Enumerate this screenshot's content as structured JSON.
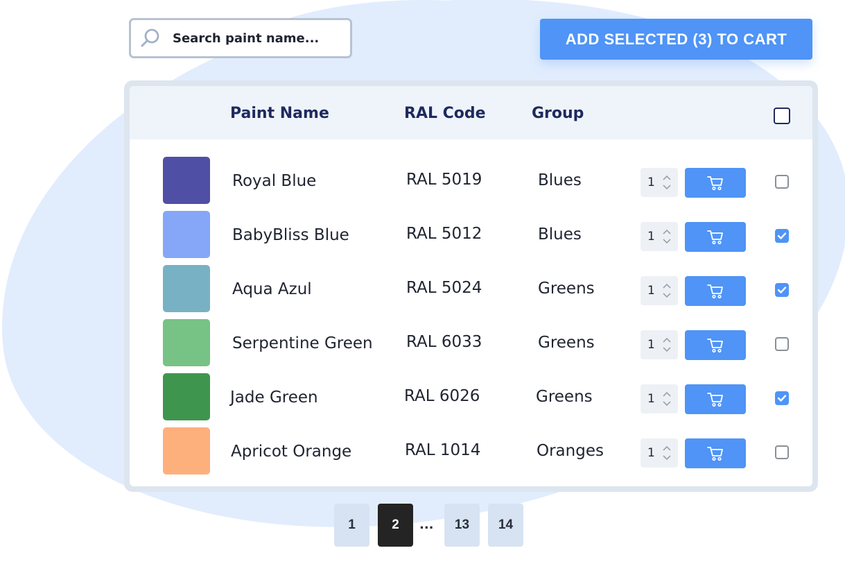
{
  "search": {
    "placeholder": "Search paint name..."
  },
  "toolbar": {
    "add_selected_label": "ADD SELECTED (3) TO CART"
  },
  "table": {
    "headers": {
      "name": "Paint Name",
      "code": "RAL Code",
      "group": "Group"
    },
    "rows": [
      {
        "name": "Royal Blue",
        "code": "RAL 5019",
        "group": "Blues",
        "qty": "1",
        "checked": false,
        "color": "#4f4fa6"
      },
      {
        "name": "BabyBliss Blue",
        "code": "RAL 5012",
        "group": "Blues",
        "qty": "1",
        "checked": true,
        "color": "#86a6f8"
      },
      {
        "name": "Aqua Azul",
        "code": "RAL 5024",
        "group": "Greens",
        "qty": "1",
        "checked": true,
        "color": "#79b1c4"
      },
      {
        "name": "Serpentine Green",
        "code": "RAL 6033",
        "group": "Greens",
        "qty": "1",
        "checked": false,
        "color": "#76c385"
      },
      {
        "name": "Jade Green",
        "code": "RAL 6026",
        "group": "Greens",
        "qty": "1",
        "checked": true,
        "color": "#3e964e"
      },
      {
        "name": "Apricot Orange",
        "code": "RAL 1014",
        "group": "Oranges",
        "qty": "1",
        "checked": false,
        "color": "#fdb07c"
      }
    ]
  },
  "pagination": {
    "pages": [
      "1",
      "2",
      "13",
      "14"
    ],
    "active": "2",
    "ellipsis": "..."
  },
  "colors": {
    "accent": "#4f94f6",
    "header_text": "#1e2a5e",
    "active_page": "#242424"
  },
  "icons": {
    "search": "search-icon",
    "cart": "cart-icon",
    "check": "check-icon",
    "stepper": "stepper-arrows-icon"
  }
}
